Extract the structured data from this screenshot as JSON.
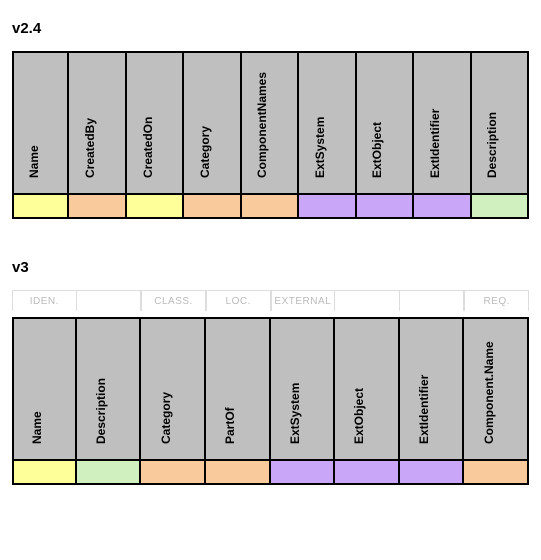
{
  "sections": {
    "v24": {
      "title": "v2.4",
      "columns": [
        {
          "label": "Name",
          "color": "c-yellow"
        },
        {
          "label": "CreatedBy",
          "color": "c-orange"
        },
        {
          "label": "CreatedOn",
          "color": "c-yellow"
        },
        {
          "label": "Category",
          "color": "c-orange"
        },
        {
          "label": "ComponentNames",
          "color": "c-orange"
        },
        {
          "label": "ExtSystem",
          "color": "c-purple"
        },
        {
          "label": "ExtObject",
          "color": "c-purple"
        },
        {
          "label": "ExtIdentifier",
          "color": "c-purple"
        },
        {
          "label": "Description",
          "color": "c-green"
        }
      ]
    },
    "v3": {
      "title": "v3",
      "groups": [
        "IDEN.",
        "",
        "CLASS.",
        "LOC.",
        "EXTERNAL",
        "",
        "",
        "REQ."
      ],
      "groupStarts": [
        true,
        false,
        true,
        true,
        true,
        false,
        false,
        true
      ],
      "columns": [
        {
          "label": "Name",
          "color": "c-yellow"
        },
        {
          "label": "Description",
          "color": "c-green"
        },
        {
          "label": "Category",
          "color": "c-orange"
        },
        {
          "label": "PartOf",
          "color": "c-orange"
        },
        {
          "label": "ExtSystem",
          "color": "c-purple"
        },
        {
          "label": "ExtObject",
          "color": "c-purple"
        },
        {
          "label": "ExtIdentifier",
          "color": "c-purple"
        },
        {
          "label": "Component.Name",
          "color": "c-orange"
        }
      ]
    }
  }
}
